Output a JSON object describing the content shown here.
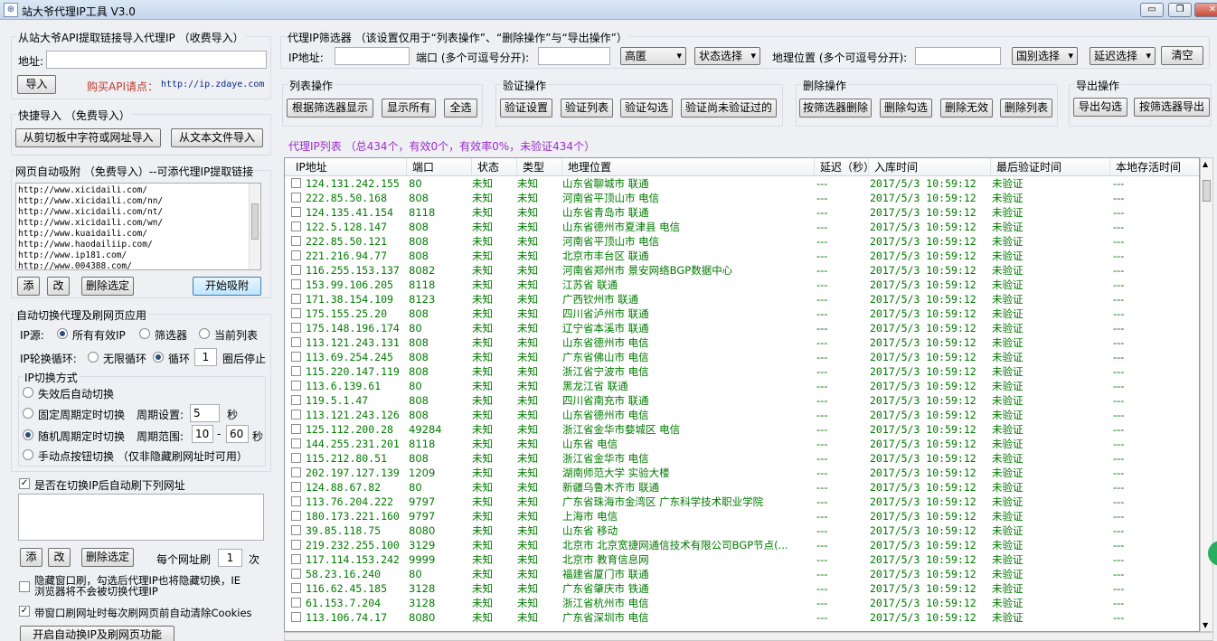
{
  "window": {
    "title": "站大爷代理IP工具 V3.0",
    "min": "▭",
    "max": "❐",
    "close": "✕"
  },
  "api": {
    "group": "从站大爷API提取链接导入代理IP （收费导入）",
    "addr_label": "地址:",
    "addr_value": "",
    "import": "导入",
    "buy": "购买API请点：",
    "buy_url": "http://ip.zdaye.com"
  },
  "quick": {
    "group": "快捷导入 （免费导入）",
    "clipboard": "从剪切板中字符或网址导入",
    "textfile": "从文本文件导入"
  },
  "absorb": {
    "group": "网页自动吸附 （免费导入）--可添代理IP提取链接",
    "urls": [
      "http://www.xicidaili.com/",
      "http://www.xicidaili.com/nn/",
      "http://www.xicidaili.com/nt/",
      "http://www.xicidaili.com/wn/",
      "http://www.kuaidaili.com/",
      "http://www.haodailiip.com/",
      "http://www.ip181.com/",
      "http://www.004388.com/"
    ],
    "add": "添",
    "edit": "改",
    "del": "删除选定",
    "start": "开始吸附"
  },
  "auto": {
    "group": "自动切换代理及刷网页应用",
    "src_label": "IP源:",
    "src_all": "所有有效IP",
    "src_filter": "筛选器",
    "src_current": "当前列表",
    "loop_label": "IP轮换循环:",
    "loop_inf": "无限循环",
    "loop_n": "循环",
    "loop_count": "1",
    "loop_stop": "圈后停止",
    "mode_group": "IP切换方式",
    "m1": "失效后自动切换",
    "m2": "固定周期定时切换",
    "period_label": "周期设置:",
    "period": "5",
    "sec": "秒",
    "m3": "随机周期定时切换",
    "range_label": "周期范围:",
    "range_min": "10",
    "range_dash": "-",
    "range_max": "60",
    "sec2": "秒",
    "m4": "手动点按钮切换 （仅非隐藏刷网址时可用）",
    "refresh_chk": "是否在切换IP后自动刷下列网址",
    "add": "添",
    "edit": "改",
    "del": "删除选定",
    "each_label": "每个网址刷",
    "each_count": "1",
    "times": "次",
    "hide_line1": "隐藏窗口刷，勾选后代理IP也将隐藏切换，IE",
    "hide_line2": "浏览器将不会被切换代理IP",
    "cookie": "带窗口刷网址时每次刷网页前自动清除Cookies",
    "start": "开启自动换IP及刷网页功能"
  },
  "filter": {
    "group": "代理IP筛选器 （该设置仅用于“列表操作”、“删除操作”与“导出操作”）",
    "ip_label": "IP地址:",
    "port_label": "端口 (多个可逗号分开):",
    "anon": "高匿",
    "status": "状态选择",
    "geo_label": "地理位置 (多个可逗号分开):",
    "isp": "国别选择",
    "delay": "延迟选择",
    "clear": "清空"
  },
  "ops": {
    "list_title": "列表操作",
    "l1": "根据筛选器显示",
    "l2": "显示所有",
    "l3": "全选",
    "verify_title": "验证操作",
    "v1": "验证设置",
    "v2": "验证列表",
    "v3": "验证勾选",
    "v4": "验证尚未验证过的",
    "delete_title": "删除操作",
    "d1": "按筛选器删除",
    "d2": "删除勾选",
    "d3": "删除无效",
    "d4": "删除列表",
    "export_title": "导出操作",
    "e1": "导出勾选",
    "e2": "按筛选器导出"
  },
  "summary": "代理IP列表 （总434个，有效0个，有效率0%，未验证434个）",
  "columns": [
    "IP地址",
    "端口",
    "状态",
    "类型",
    "地理位置",
    "延迟（秒）",
    "入库时间",
    "最后验证时间",
    "本地存活时间"
  ],
  "rows": [
    [
      "124.131.242.155",
      "80",
      "未知",
      "未知",
      "山东省聊城市 联通",
      "---",
      "2017/5/3 10:59:12",
      "未验证",
      "---"
    ],
    [
      "222.85.50.168",
      "808",
      "未知",
      "未知",
      "河南省平顶山市 电信",
      "---",
      "2017/5/3 10:59:12",
      "未验证",
      "---"
    ],
    [
      "124.135.41.154",
      "8118",
      "未知",
      "未知",
      "山东省青岛市 联通",
      "---",
      "2017/5/3 10:59:12",
      "未验证",
      "---"
    ],
    [
      "122.5.128.147",
      "808",
      "未知",
      "未知",
      "山东省德州市夏津县 电信",
      "---",
      "2017/5/3 10:59:12",
      "未验证",
      "---"
    ],
    [
      "222.85.50.121",
      "808",
      "未知",
      "未知",
      "河南省平顶山市 电信",
      "---",
      "2017/5/3 10:59:12",
      "未验证",
      "---"
    ],
    [
      "221.216.94.77",
      "808",
      "未知",
      "未知",
      "北京市丰台区 联通",
      "---",
      "2017/5/3 10:59:12",
      "未验证",
      "---"
    ],
    [
      "116.255.153.137",
      "8082",
      "未知",
      "未知",
      "河南省郑州市 景安网络BGP数据中心",
      "---",
      "2017/5/3 10:59:12",
      "未验证",
      "---"
    ],
    [
      "153.99.106.205",
      "8118",
      "未知",
      "未知",
      "江苏省 联通",
      "---",
      "2017/5/3 10:59:12",
      "未验证",
      "---"
    ],
    [
      "171.38.154.109",
      "8123",
      "未知",
      "未知",
      "广西钦州市 联通",
      "---",
      "2017/5/3 10:59:12",
      "未验证",
      "---"
    ],
    [
      "175.155.25.20",
      "808",
      "未知",
      "未知",
      "四川省泸州市 联通",
      "---",
      "2017/5/3 10:59:12",
      "未验证",
      "---"
    ],
    [
      "175.148.196.174",
      "80",
      "未知",
      "未知",
      "辽宁省本溪市 联通",
      "---",
      "2017/5/3 10:59:12",
      "未验证",
      "---"
    ],
    [
      "113.121.243.131",
      "808",
      "未知",
      "未知",
      "山东省德州市 电信",
      "---",
      "2017/5/3 10:59:12",
      "未验证",
      "---"
    ],
    [
      "113.69.254.245",
      "808",
      "未知",
      "未知",
      "广东省佛山市 电信",
      "---",
      "2017/5/3 10:59:12",
      "未验证",
      "---"
    ],
    [
      "115.220.147.119",
      "808",
      "未知",
      "未知",
      "浙江省宁波市 电信",
      "---",
      "2017/5/3 10:59:12",
      "未验证",
      "---"
    ],
    [
      "113.6.139.61",
      "80",
      "未知",
      "未知",
      "黑龙江省 联通",
      "---",
      "2017/5/3 10:59:12",
      "未验证",
      "---"
    ],
    [
      "119.5.1.47",
      "808",
      "未知",
      "未知",
      "四川省南充市 联通",
      "---",
      "2017/5/3 10:59:12",
      "未验证",
      "---"
    ],
    [
      "113.121.243.126",
      "808",
      "未知",
      "未知",
      "山东省德州市 电信",
      "---",
      "2017/5/3 10:59:12",
      "未验证",
      "---"
    ],
    [
      "125.112.200.28",
      "49284",
      "未知",
      "未知",
      "浙江省金华市婺城区 电信",
      "---",
      "2017/5/3 10:59:12",
      "未验证",
      "---"
    ],
    [
      "144.255.231.201",
      "8118",
      "未知",
      "未知",
      "山东省 电信",
      "---",
      "2017/5/3 10:59:12",
      "未验证",
      "---"
    ],
    [
      "115.212.80.51",
      "808",
      "未知",
      "未知",
      "浙江省金华市 电信",
      "---",
      "2017/5/3 10:59:12",
      "未验证",
      "---"
    ],
    [
      "202.197.127.139",
      "1209",
      "未知",
      "未知",
      "湖南师范大学 实验大楼",
      "---",
      "2017/5/3 10:59:12",
      "未验证",
      "---"
    ],
    [
      "124.88.67.82",
      "80",
      "未知",
      "未知",
      "新疆乌鲁木齐市 联通",
      "---",
      "2017/5/3 10:59:12",
      "未验证",
      "---"
    ],
    [
      "113.76.204.222",
      "9797",
      "未知",
      "未知",
      "广东省珠海市金湾区 广东科学技术职业学院",
      "---",
      "2017/5/3 10:59:12",
      "未验证",
      "---"
    ],
    [
      "180.173.221.160",
      "9797",
      "未知",
      "未知",
      "上海市 电信",
      "---",
      "2017/5/3 10:59:12",
      "未验证",
      "---"
    ],
    [
      "39.85.118.75",
      "8080",
      "未知",
      "未知",
      "山东省 移动",
      "---",
      "2017/5/3 10:59:12",
      "未验证",
      "---"
    ],
    [
      "219.232.255.100",
      "3129",
      "未知",
      "未知",
      "北京市 北京宽捷网通信技术有限公司BGP节点(...",
      "---",
      "2017/5/3 10:59:12",
      "未验证",
      "---"
    ],
    [
      "117.114.153.242",
      "9999",
      "未知",
      "未知",
      "北京市 教育信息网",
      "---",
      "2017/5/3 10:59:12",
      "未验证",
      "---"
    ],
    [
      "58.23.16.240",
      "80",
      "未知",
      "未知",
      "福建省厦门市 联通",
      "---",
      "2017/5/3 10:59:12",
      "未验证",
      "---"
    ],
    [
      "116.62.45.185",
      "3128",
      "未知",
      "未知",
      "广东省肇庆市 铁通",
      "---",
      "2017/5/3 10:59:12",
      "未验证",
      "---"
    ],
    [
      "61.153.7.204",
      "3128",
      "未知",
      "未知",
      "浙江省杭州市 电信",
      "---",
      "2017/5/3 10:59:12",
      "未验证",
      "---"
    ],
    [
      "113.106.74.17",
      "8080",
      "未知",
      "未知",
      "广东省深圳市 电信",
      "---",
      "2017/5/3 10:59:12",
      "未验证",
      "---"
    ]
  ]
}
